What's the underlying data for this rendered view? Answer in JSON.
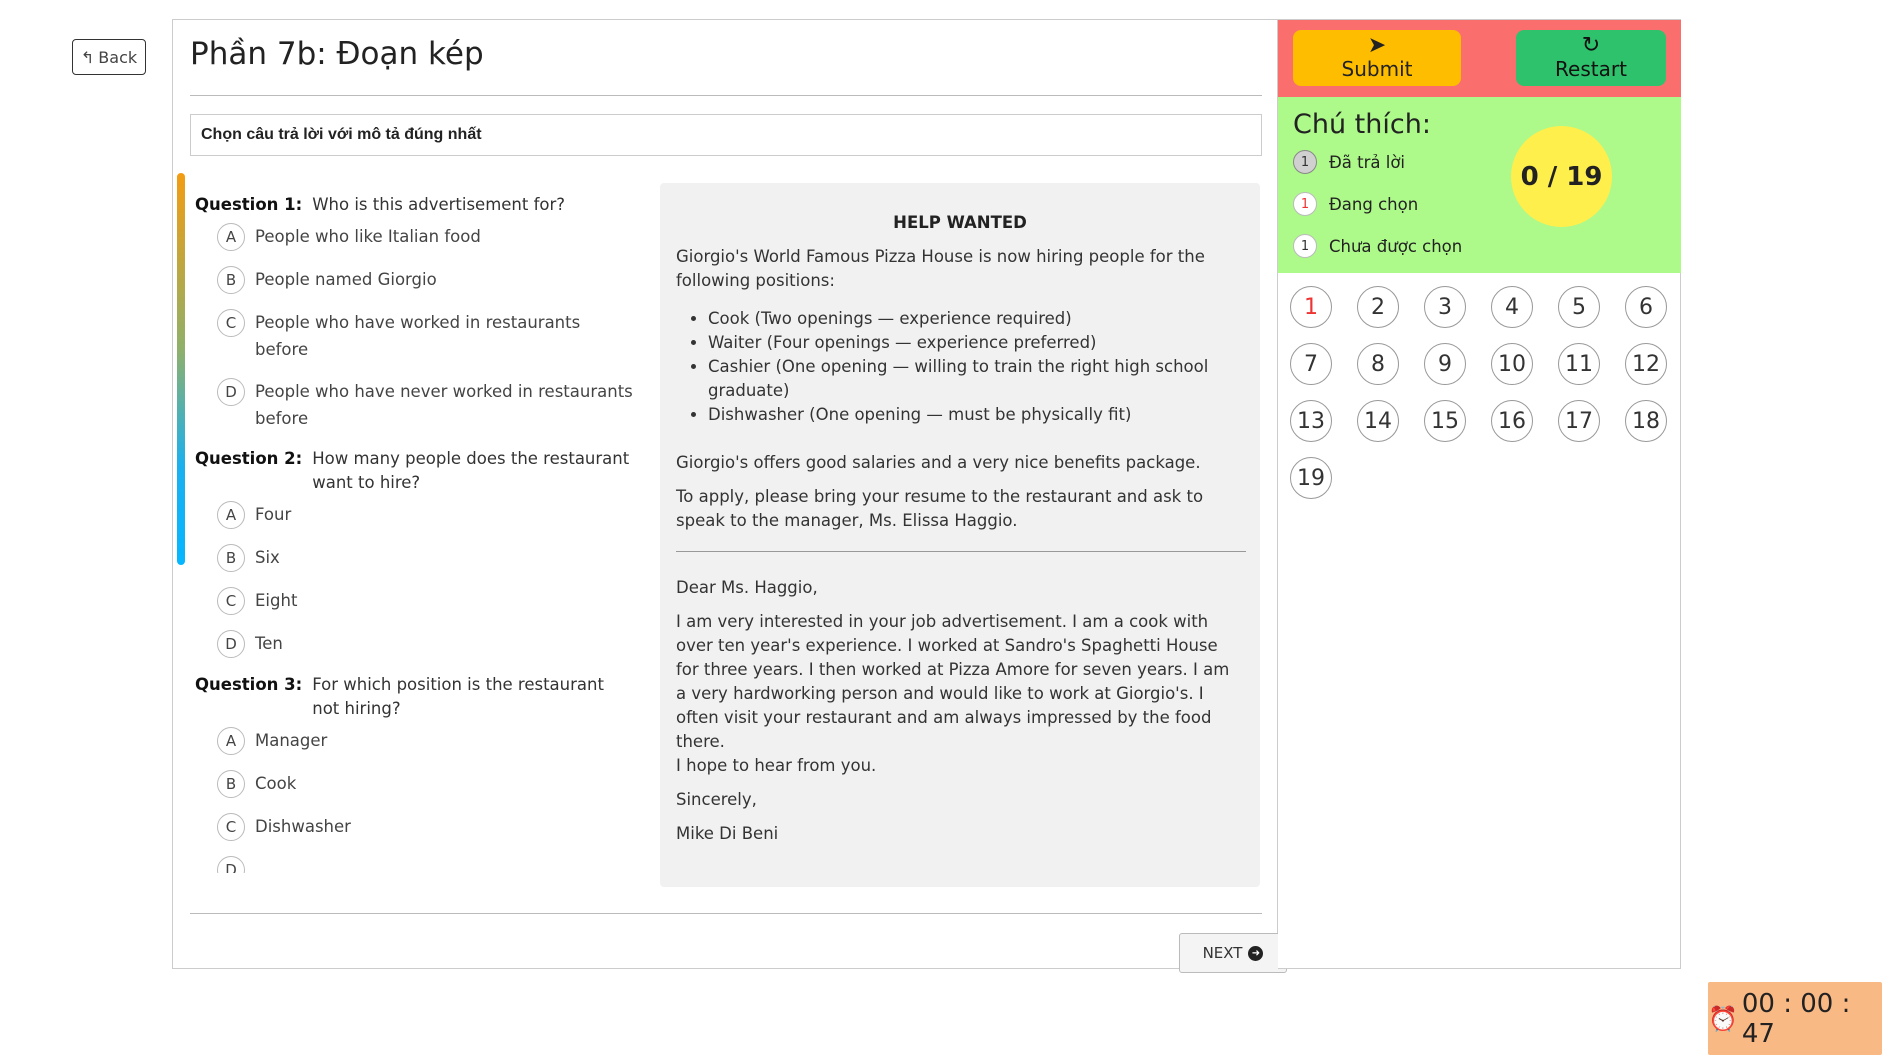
{
  "nav": {
    "back_label": "Back"
  },
  "page": {
    "title": "Phần 7b: Đoạn kép",
    "instruction": "Chọn câu trả lời với mô tả đúng nhất"
  },
  "questions": [
    {
      "label": "Question 1:",
      "text": "Who is this advertisement for?",
      "options": [
        {
          "letter": "A",
          "text": "People who like Italian food"
        },
        {
          "letter": "B",
          "text": "People named Giorgio"
        },
        {
          "letter": "C",
          "text": "People who have worked in restaurants before"
        },
        {
          "letter": "D",
          "text": "People who have never worked in restaurants before"
        }
      ]
    },
    {
      "label": "Question 2:",
      "text": "How many people does the restaurant want to hire?",
      "options": [
        {
          "letter": "A",
          "text": "Four"
        },
        {
          "letter": "B",
          "text": "Six"
        },
        {
          "letter": "C",
          "text": "Eight"
        },
        {
          "letter": "D",
          "text": "Ten"
        }
      ]
    },
    {
      "label": "Question 3:",
      "text": "For which position is the restaurant not hiring?",
      "options": [
        {
          "letter": "A",
          "text": "Manager"
        },
        {
          "letter": "B",
          "text": "Cook"
        },
        {
          "letter": "C",
          "text": "Dishwasher"
        },
        {
          "letter": "D",
          "text": ""
        }
      ]
    }
  ],
  "passage": {
    "heading": "HELP WANTED",
    "intro": "Giorgio's World Famous Pizza House is now hiring people for the following positions:",
    "positions": [
      "Cook (Two openings — experience required)",
      "Waiter (Four openings — experience preferred)",
      "Cashier (One opening — willing to train the right high school graduate)",
      "Dishwasher (One opening — must be physically fit)"
    ],
    "salary": "Giorgio's offers good salaries and a very nice benefits package.",
    "apply": "To apply, please bring your resume to the restaurant and ask to speak to the manager, Ms. Elissa Haggio.",
    "greeting": "Dear Ms. Haggio,",
    "letter_body": "I am very interested in your job advertisement. I am a cook with over ten year's experience. I worked at Sandro's Spaghetti House for three years. I then worked at Pizza Amore for seven years. I am a very hardworking person and would like to work at Giorgio's. I often visit your restaurant and am always impressed by the food there.",
    "letter_close_line": "I hope to hear from you.",
    "signoff": "Sincerely,",
    "signature": "Mike Di Beni"
  },
  "footer": {
    "next_label": "NEXT"
  },
  "sidebar": {
    "submit_label": "Submit",
    "restart_label": "Restart",
    "legend_title": "Chú thích:",
    "legend": [
      {
        "sample": "1",
        "label": "Đã trả lời"
      },
      {
        "sample": "1",
        "label": "Đang chọn"
      },
      {
        "sample": "1",
        "label": "Chưa được chọn"
      }
    ],
    "score": "0 / 19",
    "current_question": 1,
    "question_numbers": [
      "1",
      "2",
      "3",
      "4",
      "5",
      "6",
      "7",
      "8",
      "9",
      "10",
      "11",
      "12",
      "13",
      "14",
      "15",
      "16",
      "17",
      "18",
      "19"
    ]
  },
  "timer": {
    "value": "00 : 00 : 47",
    "icon": "alarm-clock-icon"
  },
  "colors": {
    "submit": "#ffbd00",
    "restart": "#2ec26c",
    "side_header": "#fb6e6e",
    "legend_bg": "#adf98a",
    "score_bg": "#ffef4c",
    "timer_bg": "#f8b985",
    "current_marker": "#e33333"
  }
}
